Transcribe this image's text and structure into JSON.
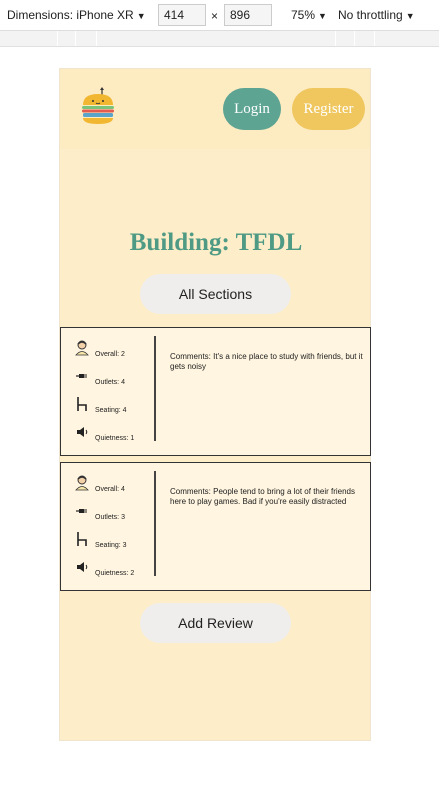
{
  "devtools": {
    "device_label": "Dimensions: iPhone XR",
    "width": "414",
    "height": "896",
    "separator": "×",
    "zoom": "75%",
    "throttling": "No throttling"
  },
  "header": {
    "login_label": "Login",
    "register_label": "Register"
  },
  "page": {
    "title": "Building: TFDL",
    "all_sections_label": "All Sections",
    "add_review_label": "Add Review"
  },
  "reviews": [
    {
      "overall": "Overall: 2",
      "outlets": "Outlets: 4",
      "seating": "Seating: 4",
      "quietness": "Quietness: 1",
      "comment": "Comments: It's a nice place to study with friends, but it gets noisy"
    },
    {
      "overall": "Overall: 4",
      "outlets": "Outlets: 3",
      "seating": "Seating: 3",
      "quietness": "Quietness: 2",
      "comment": "Comments: People tend to bring a lot of their friends here to play games. Bad if you're easily distracted"
    }
  ],
  "icons": {
    "logo": "burger-logo-icon",
    "overall": "person-icon",
    "outlets": "plug-icon",
    "seating": "chair-icon",
    "quietness": "speaker-icon"
  },
  "colors": {
    "page_bg": "#fdedc8",
    "login": "#5da493",
    "register": "#efc75e",
    "title": "#4f9a85",
    "card_bg": "#fff5e0"
  }
}
